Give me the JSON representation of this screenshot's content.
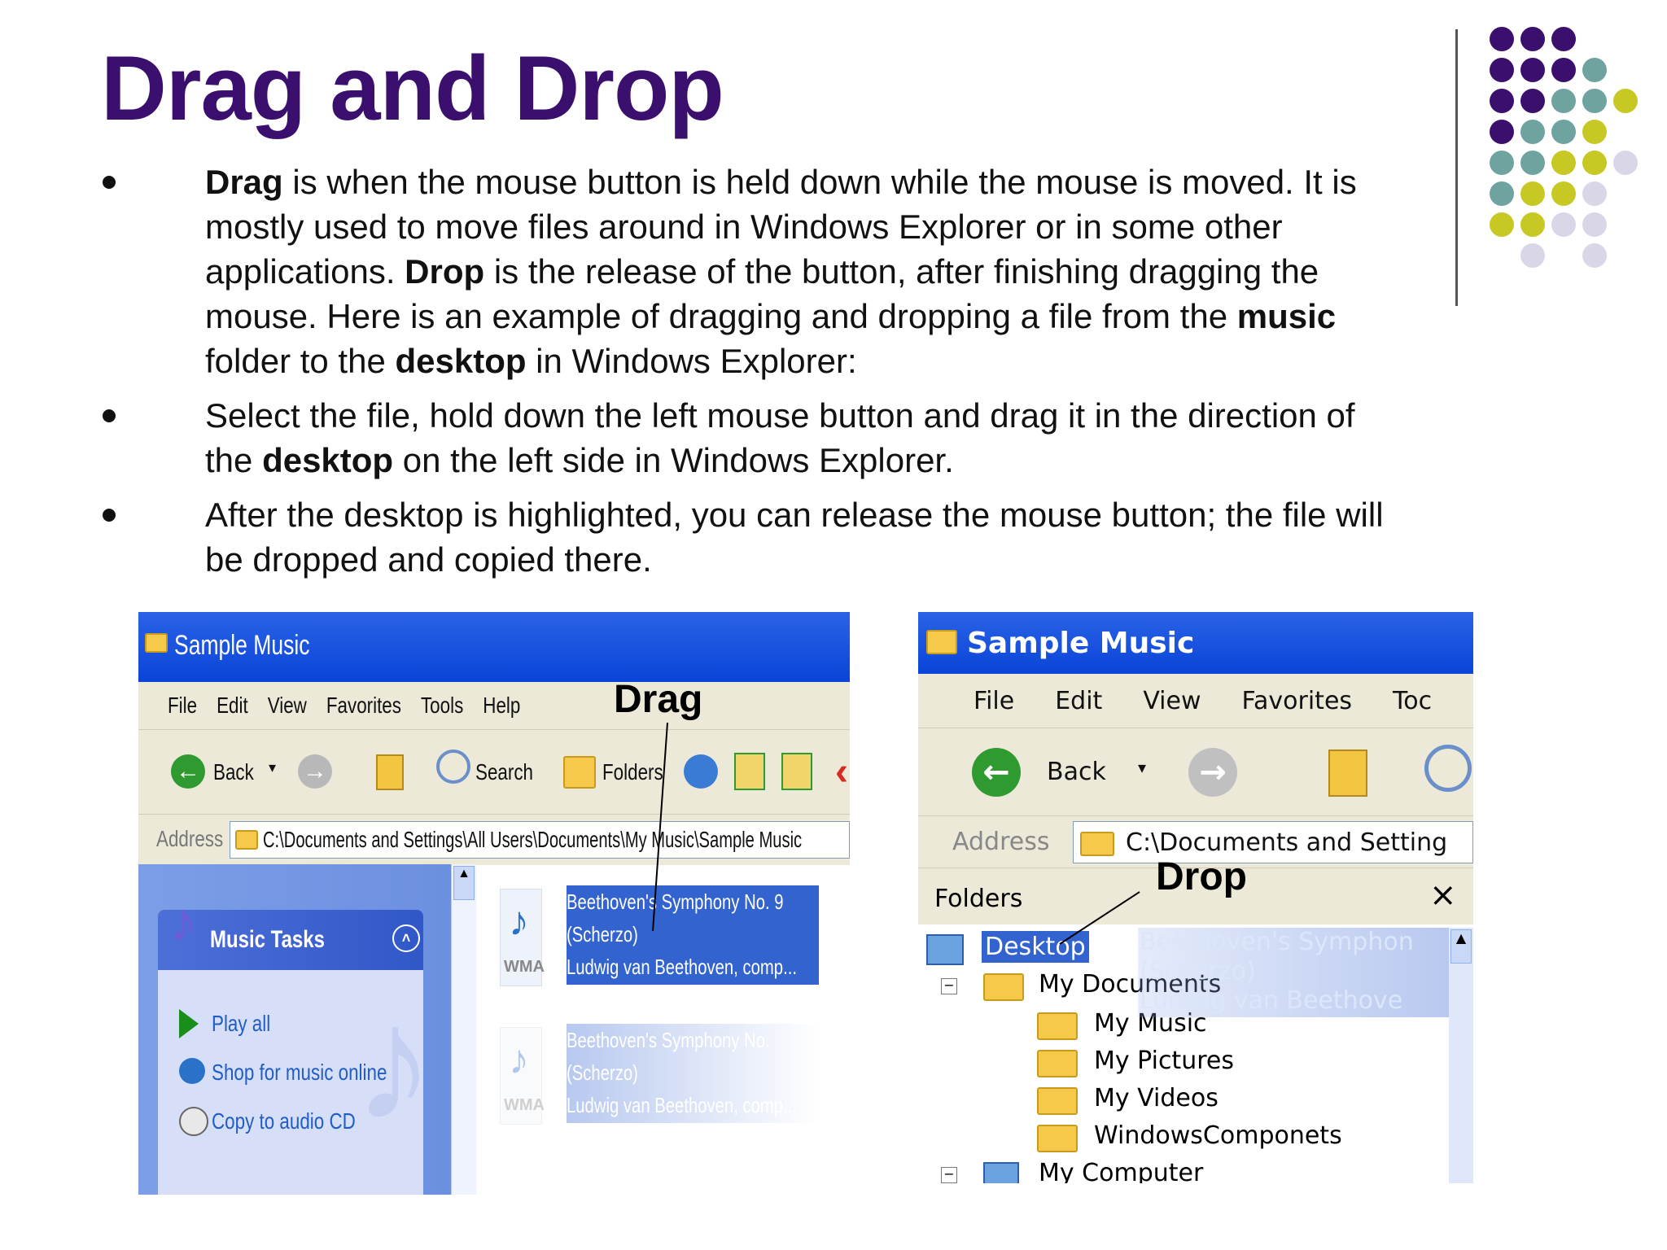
{
  "slide": {
    "title": "Drag and Drop",
    "bullets": [
      {
        "segments": [
          {
            "t": "Drag",
            "b": true
          },
          {
            "t": " is when the mouse button is held down while the mouse is moved. It is mostly used to move files around in Windows Explorer or in some other applications.  ",
            "b": false
          },
          {
            "t": "Drop",
            "b": true
          },
          {
            "t": " is the release of the button, after finishing dragging the mouse.  Here is an example of dragging and dropping a file from the ",
            "b": false
          },
          {
            "t": "music",
            "b": true
          },
          {
            "t": " folder to the ",
            "b": false
          },
          {
            "t": "desktop",
            "b": true
          },
          {
            "t": " in Windows Explorer:",
            "b": false
          }
        ]
      },
      {
        "segments": [
          {
            "t": "Select the file, hold down the left mouse button and drag it in the direction of the ",
            "b": false
          },
          {
            "t": "desktop",
            "b": true
          },
          {
            "t": " on the left side in Windows Explorer.",
            "b": false
          }
        ]
      },
      {
        "segments": [
          {
            "t": "After the desktop is highlighted, you can release the mouse button; the file will be dropped and copied there.",
            "b": false
          }
        ]
      }
    ],
    "colors": {
      "purple": "#3b0f6e",
      "teal": "#6fa3a0",
      "olive": "#c8c825",
      "lavender": "#d9d6e8",
      "title": "#3b0f6e"
    }
  },
  "screenshot_drag": {
    "title": "Sample Music",
    "menu": [
      "File",
      "Edit",
      "View",
      "Favorites",
      "Tools",
      "Help"
    ],
    "toolbar": {
      "back": "Back",
      "search": "Search",
      "folders": "Folders"
    },
    "address_label": "Address",
    "address_value": "C:\\Documents and Settings\\All Users\\Documents\\My Music\\Sample Music",
    "tasks_title": "Music Tasks",
    "tasks": [
      "Play all",
      "Shop for music online",
      "Copy to audio CD"
    ],
    "file_badge": "WMA",
    "file_lines": [
      "Beethoven's Symphony No. 9",
      "(Scherzo)",
      "Ludwig van Beethoven, comp..."
    ],
    "ghost_lines": [
      "Beethoven's Symphony No.",
      "(Scherzo)",
      "Ludwig van Beethoven, comp..."
    ],
    "annotation": "Drag"
  },
  "screenshot_drop": {
    "title": "Sample Music",
    "menu": [
      "File",
      "Edit",
      "View",
      "Favorites",
      "Toc"
    ],
    "toolbar": {
      "back": "Back"
    },
    "address_label": "Address",
    "address_value": "C:\\Documents and Setting",
    "folders_label": "Folders",
    "close": "×",
    "tree": [
      "Desktop",
      "My Documents",
      "My Music",
      "My Pictures",
      "My Videos",
      "WindowsComponets",
      "My Computer"
    ],
    "ghost_lines": [
      "Beethoven's Symphon",
      "(Scherzo)",
      "Ludwig van Beethove"
    ],
    "annotation": "Drop"
  }
}
